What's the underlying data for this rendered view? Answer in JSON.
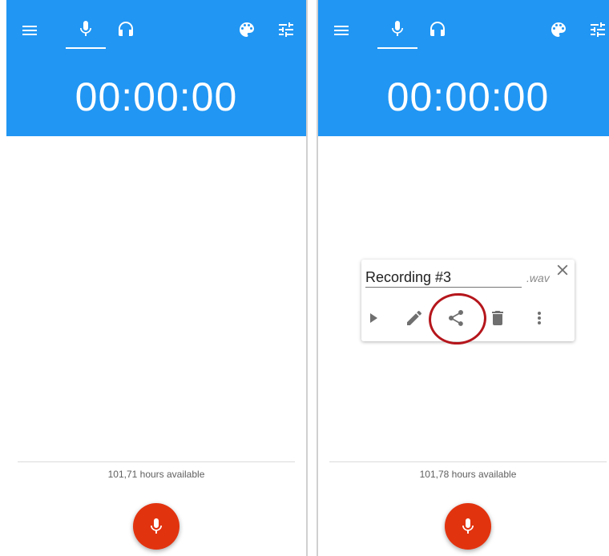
{
  "screens": [
    {
      "timer": "00:00:00",
      "available_text": "101,71 hours available",
      "icons": {
        "menu": "menu-icon",
        "mic_tab": "microphone-icon",
        "listen_tab": "headphones-icon",
        "theme": "palette-icon",
        "settings": "tune-icon",
        "record": "microphone-icon"
      }
    },
    {
      "timer": "00:00:00",
      "available_text": "101,78 hours available",
      "icons": {
        "menu": "menu-icon",
        "mic_tab": "microphone-icon",
        "listen_tab": "headphones-icon",
        "theme": "palette-icon",
        "settings": "tune-icon",
        "record": "microphone-icon"
      },
      "saved_dialog": {
        "name_value": "Recording #3",
        "extension": ".wav",
        "actions": [
          "play-icon",
          "edit-icon",
          "share-icon",
          "delete-icon",
          "more-vert-icon"
        ],
        "highlighted_action": "share"
      }
    }
  ],
  "colors": {
    "app_bar": "#2196f3",
    "record_button": "#e2330f",
    "highlight_circle": "#b5161c"
  }
}
